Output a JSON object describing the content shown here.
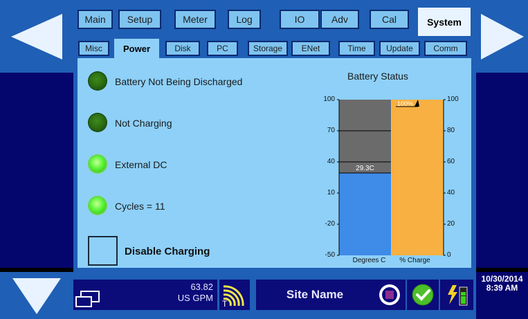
{
  "tabs": [
    {
      "label": "Main"
    },
    {
      "label": "Setup"
    },
    {
      "label": "Meter"
    },
    {
      "label": "Log"
    },
    {
      "label": "IO"
    },
    {
      "label": "Adv"
    },
    {
      "label": "Cal"
    },
    {
      "label": "System"
    }
  ],
  "active_tab": "System",
  "subtabs": [
    {
      "label": "Misc"
    },
    {
      "label": "Power"
    },
    {
      "label": "Disk"
    },
    {
      "label": "PC"
    },
    {
      "label": "Storage"
    },
    {
      "label": "ENet"
    },
    {
      "label": "Time"
    },
    {
      "label": "Update"
    },
    {
      "label": "Comm"
    }
  ],
  "active_subtab": "Power",
  "indicators": [
    {
      "label": "Battery Not Being Discharged",
      "state": "off"
    },
    {
      "label": "Not Charging",
      "state": "off"
    },
    {
      "label": "External DC",
      "state": "on"
    },
    {
      "label": "Cycles = 11",
      "state": "on"
    }
  ],
  "disable_charging": {
    "label": "Disable Charging",
    "checked": false
  },
  "chart_data": {
    "type": "bar",
    "title": "Battery Status",
    "categories": [
      "Degrees C",
      "% Charge"
    ],
    "series": [
      {
        "axis": "left",
        "unit": "C",
        "ylim": [
          -50,
          100
        ],
        "ticks": [
          "100",
          "70",
          "40",
          "10",
          "-20",
          "-50"
        ],
        "value": 29.3,
        "value_label": "29.3C",
        "color": "#3f8be8",
        "background": "#6b6b6b"
      },
      {
        "axis": "right",
        "unit": "%",
        "ylim": [
          0,
          100
        ],
        "ticks": [
          "100",
          "80",
          "60",
          "40",
          "20",
          "0"
        ],
        "value": 100,
        "value_label": "100%",
        "color": "#f7b041",
        "indicator": "charging-arrow"
      }
    ]
  },
  "status_bar": {
    "flow_value": "63.82",
    "flow_unit": "US GPM",
    "signal_icon": "wireless-signal-icon",
    "signal_badge": "T",
    "site_name": "Site Name",
    "date": "10/30/2014",
    "time": "8:39 AM"
  },
  "colors": {
    "frame": "#1f5fb5",
    "panel": "#8ed0f8",
    "side": "#05056e",
    "status": "#0b0b7a"
  }
}
